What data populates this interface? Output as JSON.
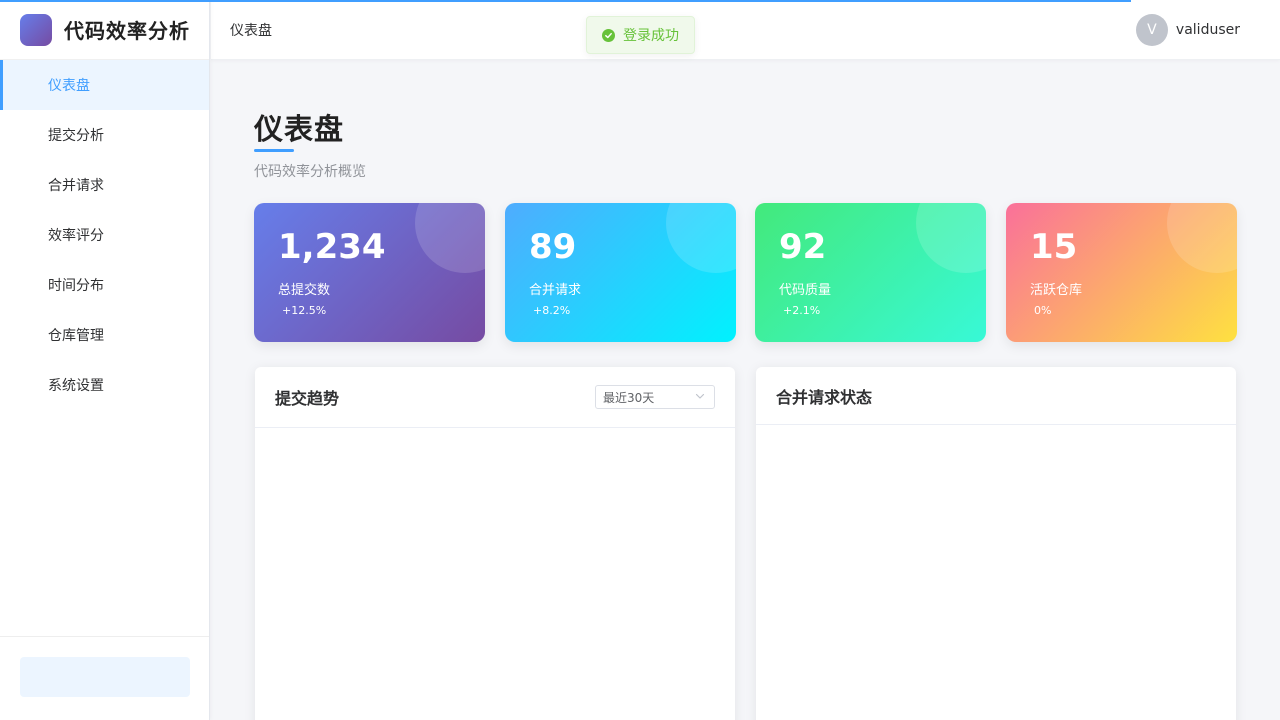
{
  "app": {
    "title": "代码效率分析"
  },
  "sidebar": {
    "items": [
      {
        "label": "仪表盘",
        "active": true
      },
      {
        "label": "提交分析"
      },
      {
        "label": "合并请求"
      },
      {
        "label": "效率评分"
      },
      {
        "label": "时间分布"
      },
      {
        "label": "仓库管理"
      },
      {
        "label": "系统设置"
      }
    ]
  },
  "header": {
    "breadcrumb": "仪表盘",
    "user": {
      "avatar_letter": "V",
      "name": "validuser"
    }
  },
  "toast": {
    "message": "登录成功",
    "type": "success"
  },
  "page": {
    "title": "仪表盘",
    "subtitle": "代码效率分析概览"
  },
  "stats": [
    {
      "value": "1,234",
      "label": "总提交数",
      "change": "+12.5%"
    },
    {
      "value": "89",
      "label": "合并请求",
      "change": "+8.2%"
    },
    {
      "value": "92",
      "label": "代码质量",
      "change": "+2.1%"
    },
    {
      "value": "15",
      "label": "活跃仓库",
      "change": "0%"
    }
  ],
  "panels": {
    "commit_trend": {
      "title": "提交趋势",
      "range_select": "最近30天"
    },
    "mr_status": {
      "title": "合并请求状态"
    }
  },
  "colors": {
    "accent": "#409eff",
    "success": "#67c23a"
  }
}
